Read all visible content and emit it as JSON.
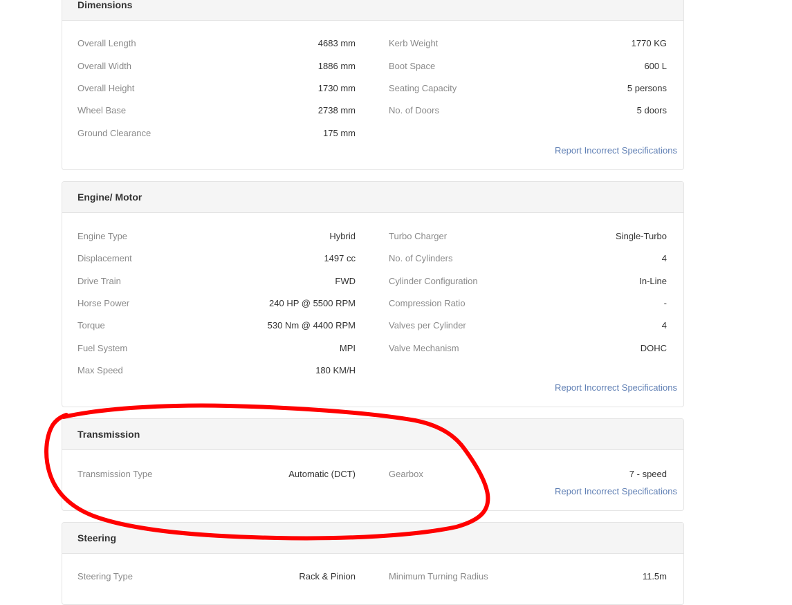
{
  "dimensions": {
    "title": "Dimensions",
    "left": [
      {
        "label": "Overall Length",
        "value": "4683 mm"
      },
      {
        "label": "Overall Width",
        "value": "1886 mm"
      },
      {
        "label": "Overall Height",
        "value": "1730 mm"
      },
      {
        "label": "Wheel Base",
        "value": "2738 mm"
      },
      {
        "label": "Ground Clearance",
        "value": "175 mm"
      }
    ],
    "right": [
      {
        "label": "Kerb Weight",
        "value": "1770 KG"
      },
      {
        "label": "Boot Space",
        "value": "600 L"
      },
      {
        "label": "Seating Capacity",
        "value": "5 persons"
      },
      {
        "label": "No. of Doors",
        "value": "5 doors"
      }
    ],
    "report_link": "Report Incorrect Specifications"
  },
  "engine": {
    "title": "Engine/ Motor",
    "left": [
      {
        "label": "Engine Type",
        "value": "Hybrid"
      },
      {
        "label": "Displacement",
        "value": "1497 cc"
      },
      {
        "label": "Drive Train",
        "value": "FWD"
      },
      {
        "label": "Horse Power",
        "value": "240 HP @ 5500 RPM"
      },
      {
        "label": "Torque",
        "value": "530 Nm @ 4400 RPM"
      },
      {
        "label": "Fuel System",
        "value": "MPI"
      },
      {
        "label": "Max Speed",
        "value": "180 KM/H"
      }
    ],
    "right": [
      {
        "label": "Turbo Charger",
        "value": "Single-Turbo"
      },
      {
        "label": "No. of Cylinders",
        "value": "4"
      },
      {
        "label": "Cylinder Configuration",
        "value": "In-Line"
      },
      {
        "label": "Compression Ratio",
        "value": "-"
      },
      {
        "label": "Valves per Cylinder",
        "value": "4"
      },
      {
        "label": "Valve Mechanism",
        "value": "DOHC"
      }
    ],
    "report_link": "Report Incorrect Specifications"
  },
  "transmission": {
    "title": "Transmission",
    "left": [
      {
        "label": "Transmission Type",
        "value": "Automatic (DCT)"
      }
    ],
    "right": [
      {
        "label": "Gearbox",
        "value": "7 - speed"
      }
    ],
    "report_link": "Report Incorrect Specifications"
  },
  "steering": {
    "title": "Steering",
    "left": [
      {
        "label": "Steering Type",
        "value": "Rack & Pinion"
      }
    ],
    "right": [
      {
        "label": "Minimum Turning Radius",
        "value": "11.5m"
      }
    ]
  },
  "colors": {
    "link": "#5f7fb4",
    "annotation": "#ff0000",
    "header_bg": "#f5f5f5"
  }
}
